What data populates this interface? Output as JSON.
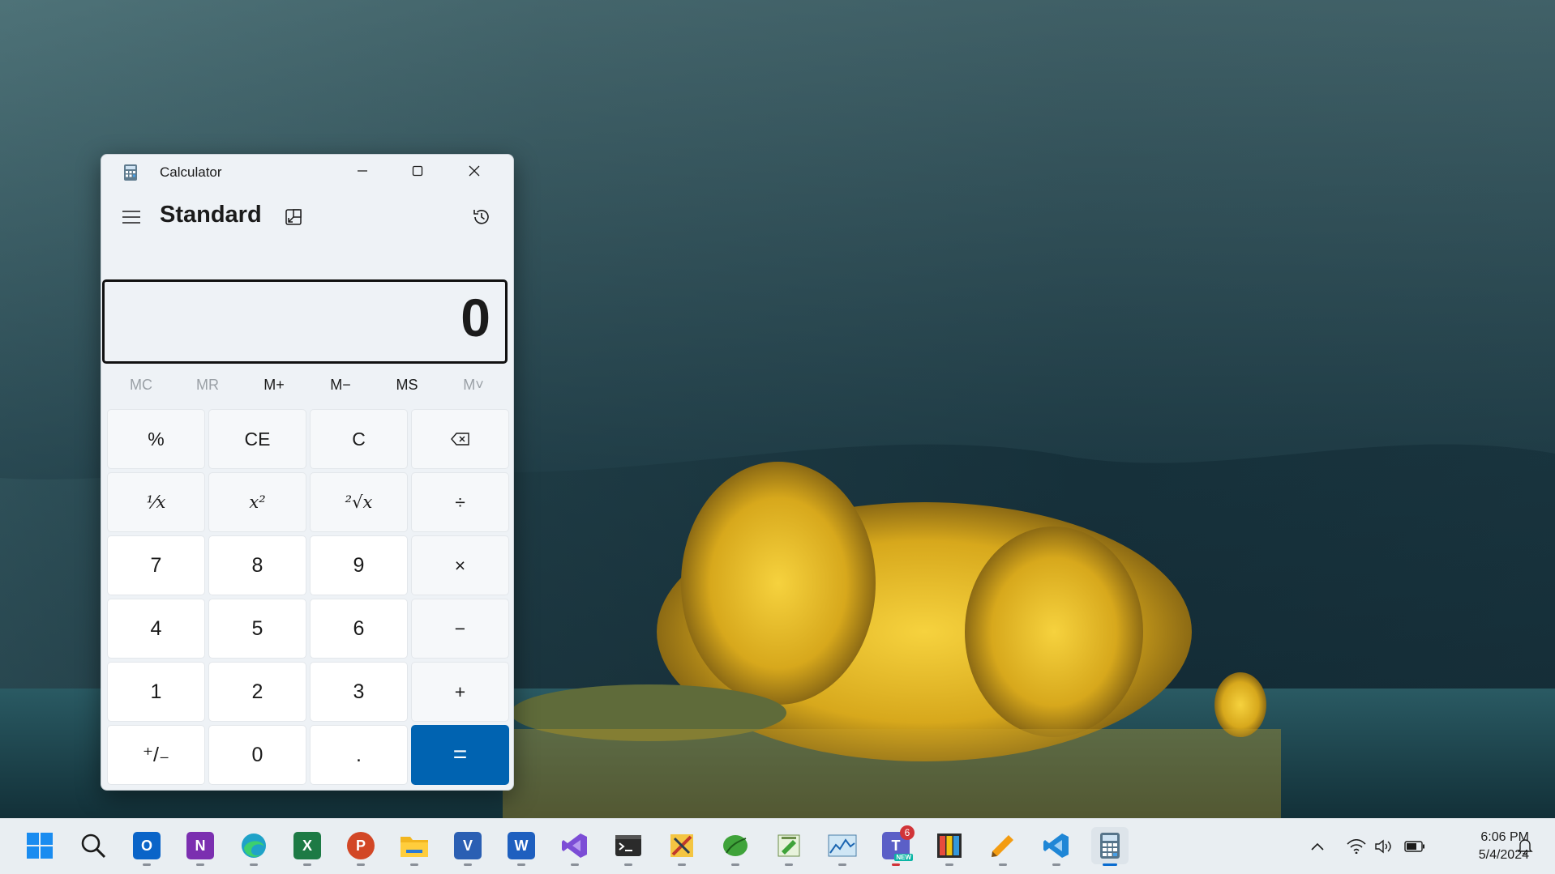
{
  "window": {
    "title": "Calculator",
    "mode": "Standard"
  },
  "display": {
    "value": "0"
  },
  "memory": [
    {
      "label": "MC",
      "enabled": false
    },
    {
      "label": "MR",
      "enabled": false
    },
    {
      "label": "M+",
      "enabled": true
    },
    {
      "label": "M−",
      "enabled": true
    },
    {
      "label": "MS",
      "enabled": true
    },
    {
      "label": "M˅",
      "enabled": false
    }
  ],
  "keys": {
    "percent": "%",
    "ce": "CE",
    "c": "C",
    "reciprocal": "⅟x",
    "square": "x²",
    "sqrt": "²√x",
    "divide": "÷",
    "multiply": "×",
    "minus": "−",
    "plus": "+",
    "negate": "⁺/₋",
    "decimal": ".",
    "equals": "=",
    "d0": "0",
    "d1": "1",
    "d2": "2",
    "d3": "3",
    "d4": "4",
    "d5": "5",
    "d6": "6",
    "d7": "7",
    "d8": "8",
    "d9": "9"
  },
  "colors": {
    "accent": "#0063b1",
    "window_bg": "#eef2f6",
    "taskbar_bg": "#e9eef2"
  },
  "taskbar": {
    "apps": [
      {
        "name": "start"
      },
      {
        "name": "search"
      },
      {
        "name": "outlook",
        "letter": "O"
      },
      {
        "name": "onenote",
        "letter": "N"
      },
      {
        "name": "edge"
      },
      {
        "name": "excel",
        "letter": "X"
      },
      {
        "name": "powerpoint",
        "letter": "P"
      },
      {
        "name": "file-explorer"
      },
      {
        "name": "visio",
        "letter": "V"
      },
      {
        "name": "word",
        "letter": "W"
      },
      {
        "name": "visual-studio"
      },
      {
        "name": "terminal"
      },
      {
        "name": "app-tools"
      },
      {
        "name": "app-leaf"
      },
      {
        "name": "app-notepad"
      },
      {
        "name": "app-resource-monitor"
      },
      {
        "name": "teams",
        "letter": "T",
        "badge": "6",
        "tag": "NEW"
      },
      {
        "name": "app-color-grid"
      },
      {
        "name": "app-pen"
      },
      {
        "name": "vscode"
      },
      {
        "name": "calculator"
      }
    ],
    "clock": {
      "time": "6:06 PM",
      "date": "5/4/2024"
    }
  }
}
